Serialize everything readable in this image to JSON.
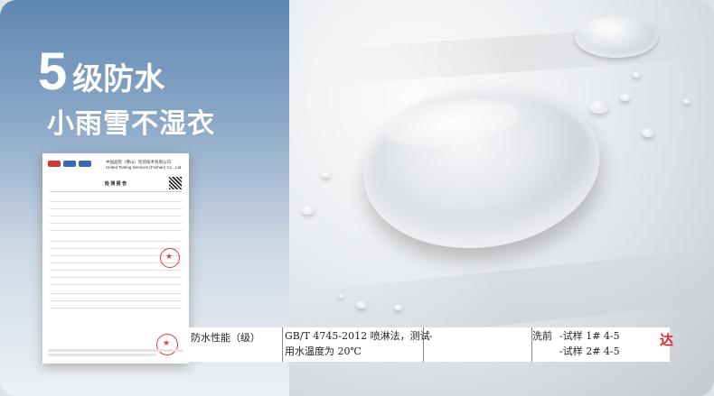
{
  "hero": {
    "title_number": "5",
    "title_level": "级防水",
    "subtitle": "小雨雪不湿衣"
  },
  "report": {
    "title": "检 测 报 告",
    "header_lines": [
      "中国品检（佛山）检验技术有限公司",
      "United Testing Services (Foshan) Co., Ltd"
    ]
  },
  "table_strip": {
    "col1": "防水性能（级）",
    "col2_line1": "GB/T 4745-2012  喷淋法，测试",
    "col2_line2": "用水温度为 20℃",
    "col3": "--",
    "col4_label": "洗前",
    "col4_rows": [
      "-试样 1#  4-5",
      "-试样 2#  4-5"
    ],
    "red_mark": "达"
  },
  "colors": {
    "left_gradient_top": "#5f87b3",
    "stamp_red": "#e23b3b",
    "red_mark": "#d8282f"
  }
}
